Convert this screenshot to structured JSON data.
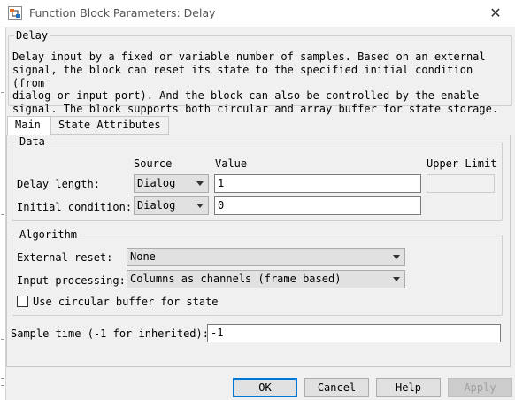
{
  "window": {
    "title": "Function Block Parameters: Delay",
    "close_glyph": "✕"
  },
  "block": {
    "name": "Delay",
    "description": "Delay input by a fixed or variable number of samples. Based on an external\nsignal, the block can reset its state to the specified initial condition (from\ndialog or input port). And the block can also be controlled by the enable\nsignal. The block supports both circular and array buffer for state storage."
  },
  "tabs": [
    {
      "label": "Main",
      "active": true
    },
    {
      "label": "State Attributes",
      "active": false
    }
  ],
  "data_group": {
    "title": "Data",
    "headers": {
      "source": "Source",
      "value": "Value",
      "upper_limit": "Upper Limit"
    },
    "rows": [
      {
        "label": "Delay length:",
        "source": "Dialog",
        "value": "1",
        "upper_limit": ""
      },
      {
        "label": "Initial condition:",
        "source": "Dialog",
        "value": "0"
      }
    ]
  },
  "algorithm_group": {
    "title": "Algorithm",
    "external_reset": {
      "label": "External reset:",
      "value": "None"
    },
    "input_processing": {
      "label": "Input processing:",
      "value": "Columns as channels (frame based)"
    },
    "circular_buffer": {
      "label": "Use circular buffer for state",
      "checked": false
    }
  },
  "sample_time": {
    "label": "Sample time (-1 for inherited):",
    "value": "-1"
  },
  "buttons": {
    "ok": "OK",
    "cancel": "Cancel",
    "help": "Help",
    "apply": "Apply"
  }
}
